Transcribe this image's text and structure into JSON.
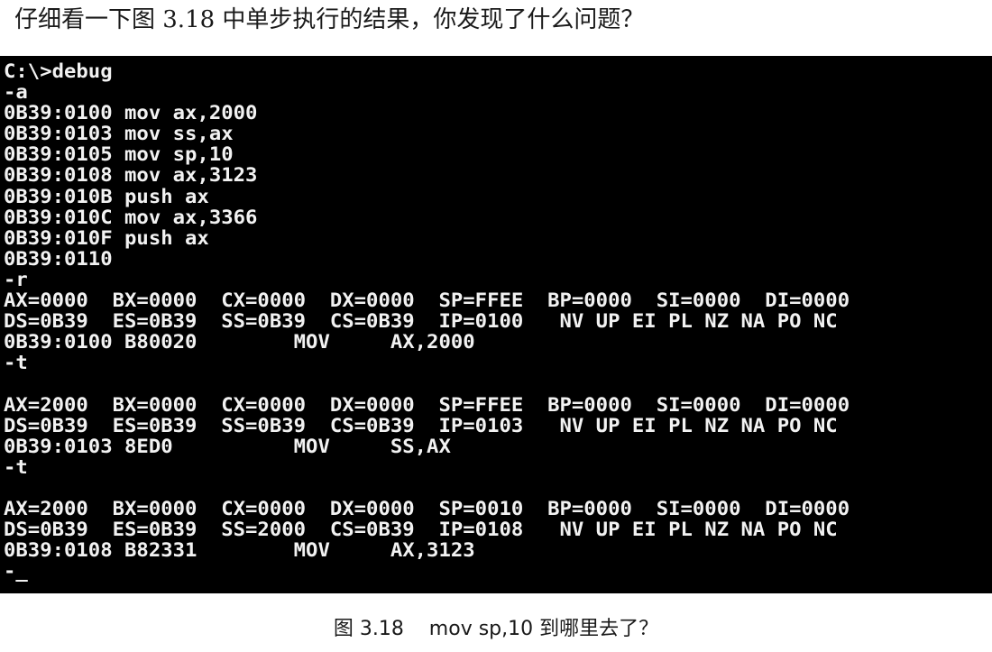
{
  "question_text": "仔细看一下图 3.18 中单步执行的结果，你发现了什么问题？",
  "console": {
    "lines": [
      "C:\\>debug",
      "-a",
      "0B39:0100 mov ax,2000",
      "0B39:0103 mov ss,ax",
      "0B39:0105 mov sp,10",
      "0B39:0108 mov ax,3123",
      "0B39:010B push ax",
      "0B39:010C mov ax,3366",
      "0B39:010F push ax",
      "0B39:0110",
      "-r",
      "AX=0000  BX=0000  CX=0000  DX=0000  SP=FFEE  BP=0000  SI=0000  DI=0000",
      "DS=0B39  ES=0B39  SS=0B39  CS=0B39  IP=0100   NV UP EI PL NZ NA PO NC",
      "0B39:0100 B80020        MOV     AX,2000",
      "-t",
      "",
      "AX=2000  BX=0000  CX=0000  DX=0000  SP=FFEE  BP=0000  SI=0000  DI=0000",
      "DS=0B39  ES=0B39  SS=0B39  CS=0B39  IP=0103   NV UP EI PL NZ NA PO NC",
      "0B39:0103 8ED0          MOV     SS,AX",
      "-t",
      "",
      "AX=2000  BX=0000  CX=0000  DX=0000  SP=0010  BP=0000  SI=0000  DI=0000",
      "DS=0B39  ES=0B39  SS=2000  CS=0B39  IP=0108   NV UP EI PL NZ NA PO NC",
      "0B39:0108 B82331        MOV     AX,3123",
      "-_"
    ]
  },
  "caption_text": "图 3.18    mov sp,10 到哪里去了？"
}
